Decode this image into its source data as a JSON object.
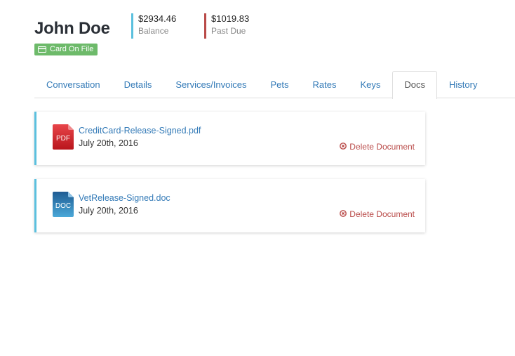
{
  "customer": {
    "name": "John Doe",
    "card_badge": "Card On File"
  },
  "stats": {
    "balance": {
      "amount": "$2934.46",
      "label": "Balance",
      "color": "#5bc0de"
    },
    "past_due": {
      "amount": "$1019.83",
      "label": "Past Due",
      "color": "#b94a48"
    }
  },
  "tabs": [
    {
      "label": "Conversation"
    },
    {
      "label": "Details"
    },
    {
      "label": "Services/Invoices"
    },
    {
      "label": "Pets"
    },
    {
      "label": "Rates"
    },
    {
      "label": "Keys"
    },
    {
      "label": "Docs",
      "active": true
    },
    {
      "label": "History"
    }
  ],
  "documents": [
    {
      "icon": "pdf-file-icon",
      "icon_text": "PDF",
      "name": "CreditCard-Release-Signed.pdf",
      "date": "July 20th, 2016",
      "delete_label": "Delete Document"
    },
    {
      "icon": "doc-file-icon",
      "icon_text": "DOC",
      "name": "VetRelease-Signed.doc",
      "date": "July 20th, 2016",
      "delete_label": "Delete Document"
    }
  ],
  "colors": {
    "accent": "#337ab7",
    "badge_green": "#6dba6a",
    "danger": "#b94a48",
    "info": "#5bc0de"
  }
}
